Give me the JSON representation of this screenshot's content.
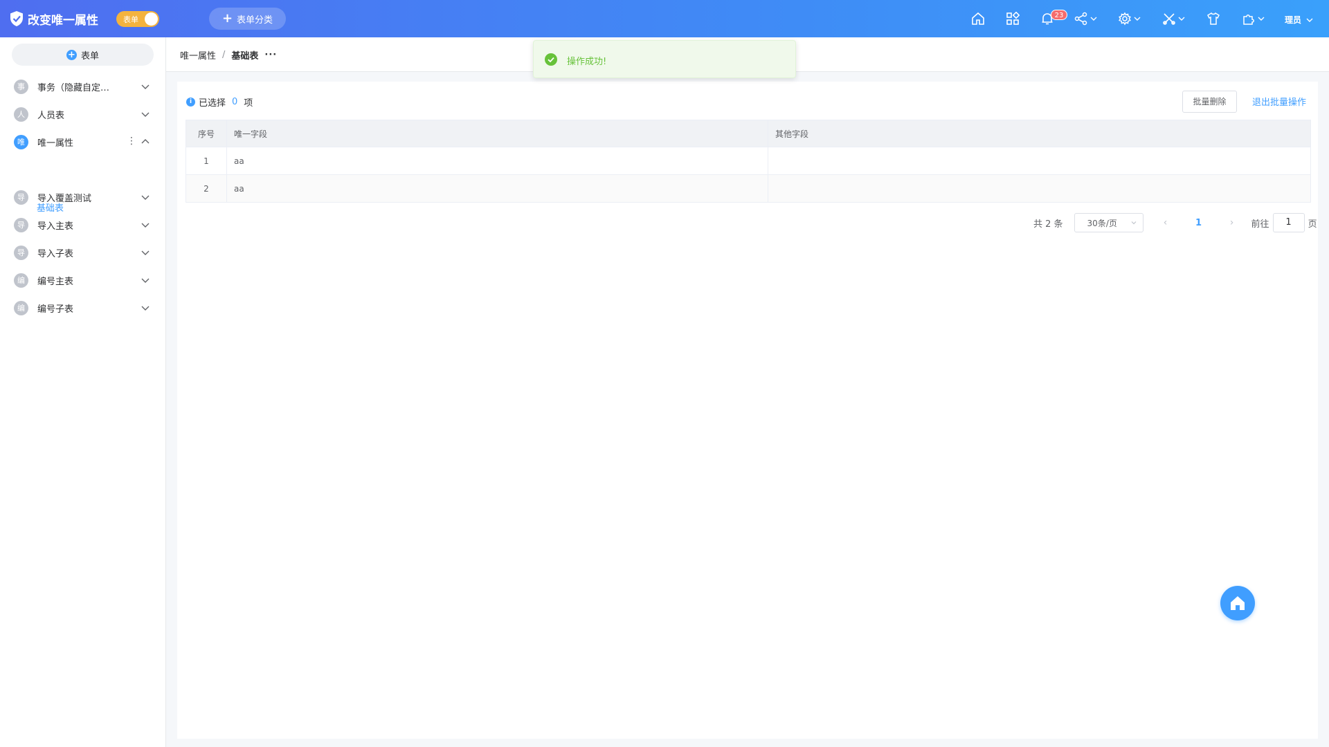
{
  "header": {
    "app_title": "改变唯一属性",
    "mode_toggle_label": "表单",
    "add_category_label": "表单分类",
    "notification_count": "23",
    "user_name": "理员",
    "icons": [
      "home-icon",
      "apps-icon",
      "bell-icon",
      "share-icon",
      "gear-icon",
      "tools-icon",
      "shirt-icon",
      "plugin-icon"
    ]
  },
  "sidebar": {
    "add_label": "表单",
    "items": [
      {
        "avatar": "事",
        "label": "事务（隐藏自定…",
        "expanded": false
      },
      {
        "avatar": "人",
        "label": "人员表",
        "expanded": false
      },
      {
        "avatar": "唯",
        "label": "唯一属性",
        "expanded": true
      },
      {
        "avatar": "导",
        "label": "导入覆盖测试",
        "expanded": false
      },
      {
        "avatar": "导",
        "label": "导入主表",
        "expanded": false
      },
      {
        "avatar": "导",
        "label": "导入子表",
        "expanded": false
      },
      {
        "avatar": "编",
        "label": "编号主表",
        "expanded": false
      },
      {
        "avatar": "编",
        "label": "编号子表",
        "expanded": false
      }
    ],
    "sub_item": "基础表"
  },
  "breadcrumb": {
    "parent": "唯一属性",
    "separator": "/",
    "current": "基础表",
    "more": "···"
  },
  "toast": {
    "message": "操作成功!"
  },
  "selection": {
    "prefix": "已选择",
    "count": "0",
    "suffix": "项"
  },
  "actions": {
    "batch_delete": "批量删除",
    "exit_batch": "退出批量操作"
  },
  "table": {
    "columns": [
      "序号",
      "唯一字段",
      "其他字段"
    ],
    "rows": [
      {
        "idx": "1",
        "unique": "aa",
        "other": ""
      },
      {
        "idx": "2",
        "unique": "aa",
        "other": ""
      }
    ]
  },
  "pagination": {
    "total": "共 2 条",
    "page_size": "30条/页",
    "current_page": "1",
    "goto_label": "前往",
    "goto_value": "1",
    "page_suffix": "页"
  },
  "colors": {
    "primary": "#409eff",
    "header_start": "#4f6ef0",
    "header_end": "#3aa0fb",
    "toggle": "#f4b33e",
    "success": "#67c23a",
    "badge": "#f56c6c"
  }
}
